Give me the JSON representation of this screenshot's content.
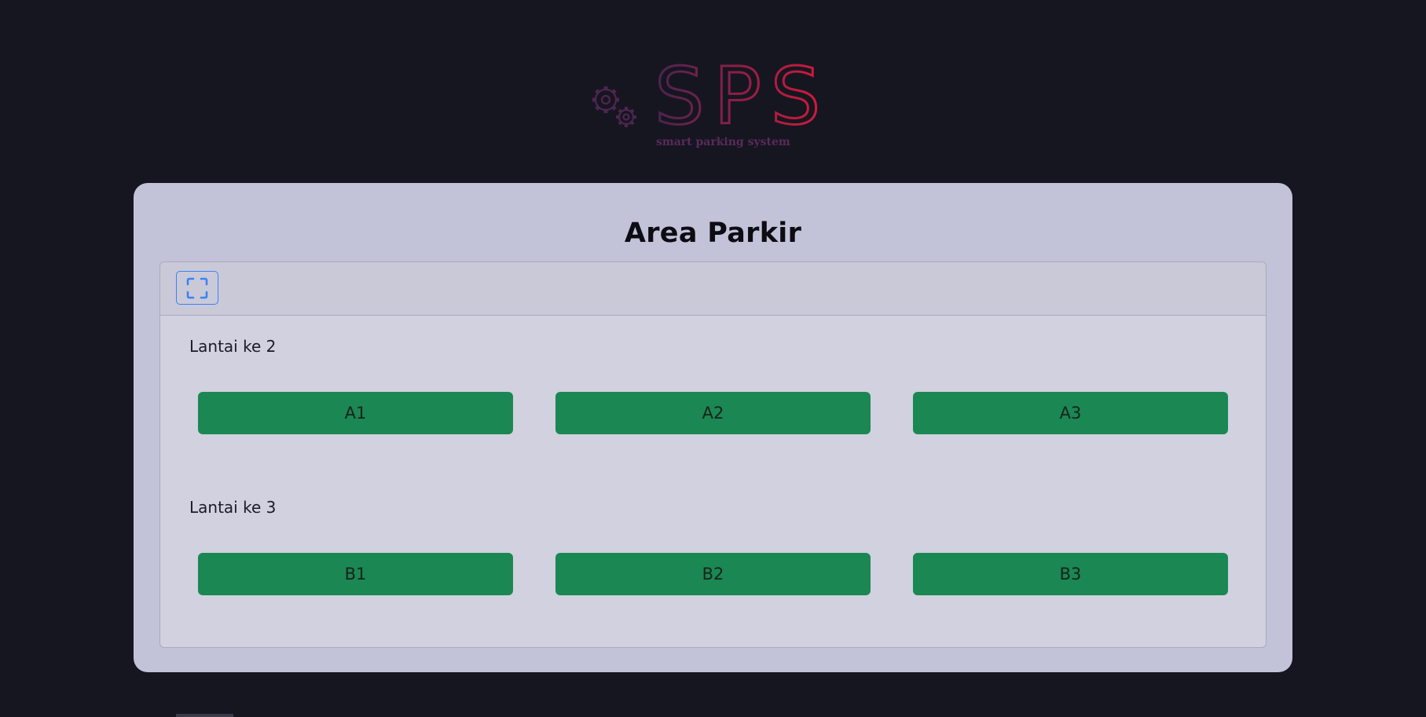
{
  "logo": {
    "text": "SPS",
    "tagline": "smart parking system",
    "icon": "gears-icon",
    "gradient_start": "#5a2660",
    "gradient_end": "#d81a3a"
  },
  "page": {
    "title": "Area Parkir"
  },
  "toolbar": {
    "fullscreen_icon": "fullscreen-icon",
    "accent": "#3b82f6"
  },
  "floors": [
    {
      "label": "Lantai ke 2",
      "slots": [
        {
          "label": "A1",
          "status_color": "#1b8753"
        },
        {
          "label": "A2",
          "status_color": "#1b8753"
        },
        {
          "label": "A3",
          "status_color": "#1b8753"
        }
      ]
    },
    {
      "label": "Lantai ke 3",
      "slots": [
        {
          "label": "B1",
          "status_color": "#1b8753"
        },
        {
          "label": "B2",
          "status_color": "#1b8753"
        },
        {
          "label": "B3",
          "status_color": "#1b8753"
        }
      ]
    }
  ]
}
